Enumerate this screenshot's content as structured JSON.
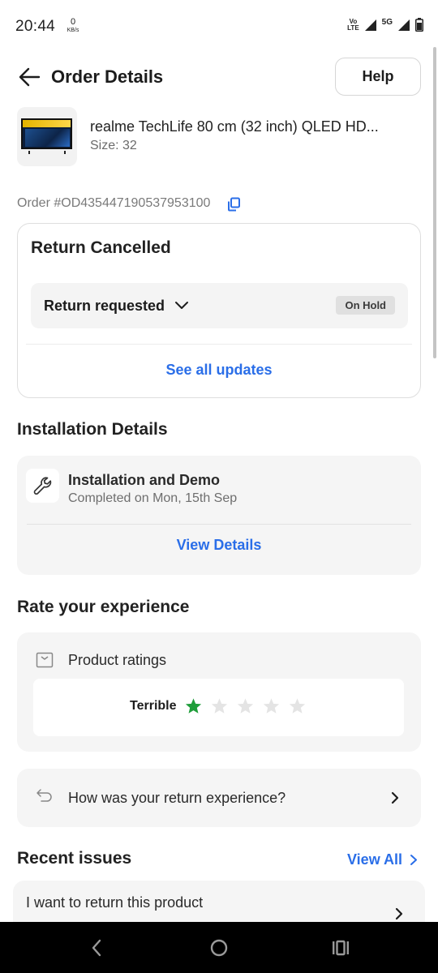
{
  "status_bar": {
    "time": "20:44",
    "speed_value": "0",
    "speed_unit": "KB/s",
    "volte_line1": "Vo",
    "volte_line2": "LTE",
    "network": "5G"
  },
  "header": {
    "title": "Order Details",
    "help_label": "Help"
  },
  "product": {
    "name": "realme TechLife 80 cm (32 inch) QLED HD...",
    "size": "Size: 32"
  },
  "order": {
    "id": "Order #OD435447190537953100"
  },
  "return_card": {
    "title": "Return Cancelled",
    "status_label": "Return requested",
    "badge": "On Hold",
    "link": "See all updates"
  },
  "installation": {
    "section_title": "Installation Details",
    "title": "Installation and Demo",
    "subtitle": "Completed on Mon, 15th Sep",
    "link": "View Details"
  },
  "rating": {
    "section_title": "Rate your experience",
    "label": "Product ratings",
    "rating_word": "Terrible",
    "stars_filled": 1,
    "stars_total": 5,
    "filled_color": "#1f9d3a",
    "empty_color": "#e4e4e4"
  },
  "return_experience": {
    "label": "How was your return experience?"
  },
  "recent_issues": {
    "section_title": "Recent issues",
    "view_all": "View All",
    "items": [
      {
        "text": "I want to return this product"
      }
    ]
  },
  "colors": {
    "link": "#2a6ee8",
    "text": "#222222",
    "muted": "#6e6e6e"
  }
}
